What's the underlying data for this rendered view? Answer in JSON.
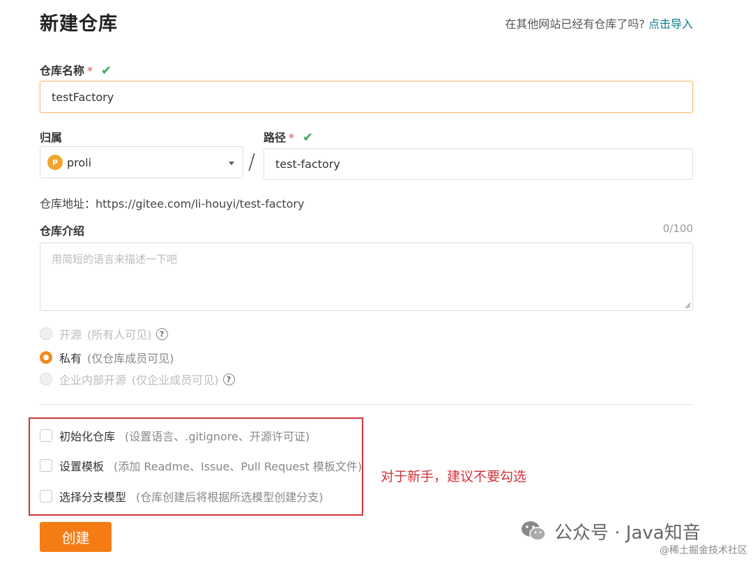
{
  "header": {
    "title": "新建仓库",
    "import_prompt": "在其他网站已经有仓库了吗?",
    "import_link": "点击导入"
  },
  "repo_name": {
    "label": "仓库名称",
    "required_mark": "*",
    "valid_mark": "✔",
    "value": "testFactory"
  },
  "owner": {
    "label": "归属",
    "avatar_letter": "P",
    "value": "proli"
  },
  "path": {
    "separator": "/",
    "label": "路径",
    "required_mark": "*",
    "valid_mark": "✔",
    "value": "test-factory"
  },
  "repo_url": {
    "text": "仓库地址：https://gitee.com/li-houyi/test-factory"
  },
  "description": {
    "label": "仓库介绍",
    "counter": "0/100",
    "placeholder": "用简短的语言来描述一下吧",
    "value": ""
  },
  "visibility": {
    "options": [
      {
        "label": "开源",
        "note": "(所有人可见)",
        "help": "?",
        "state": "disabled"
      },
      {
        "label": "私有",
        "note": "(仅仓库成员可见)",
        "state": "checked"
      },
      {
        "label": "企业内部开源",
        "note": "(仅企业成员可见)",
        "help": "?",
        "state": "disabled"
      }
    ]
  },
  "init_options": [
    {
      "label": "初始化仓库",
      "note": "(设置语言、.gitignore、开源许可证)",
      "checked": false
    },
    {
      "label": "设置模板",
      "note": "(添加 Readme、Issue、Pull Request 模板文件)",
      "checked": false
    },
    {
      "label": "选择分支模型",
      "note": "(仓库创建后将根据所选模型创建分支)",
      "checked": false
    }
  ],
  "annotation": "对于新手，建议不要勾选",
  "create_button": "创建",
  "watermark": {
    "main": "公众号 · Java知音",
    "sub": "@稀土掘金技术社区"
  },
  "colors": {
    "accent": "#f57c15",
    "link": "#0b7a8a",
    "valid": "#3aa757",
    "annotation_red": "#d0343a"
  }
}
